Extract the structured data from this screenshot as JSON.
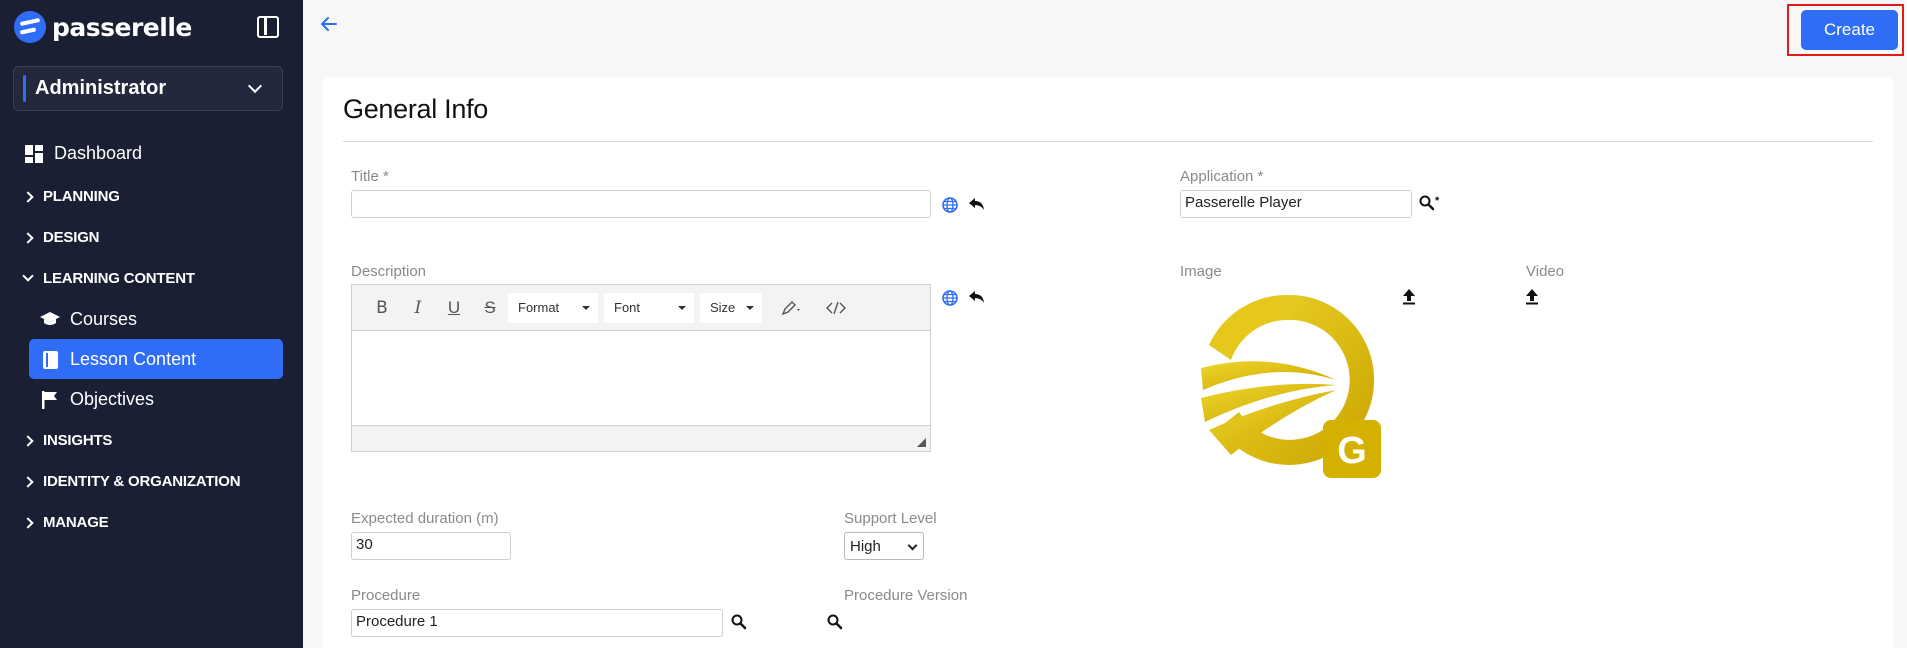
{
  "app": {
    "brand": "passerelle"
  },
  "sidebar": {
    "role": "Administrator",
    "top_item": "Dashboard",
    "sections": [
      {
        "label": "PLANNING"
      },
      {
        "label": "DESIGN"
      },
      {
        "label": "LEARNING CONTENT"
      },
      {
        "label": "INSIGHTS"
      },
      {
        "label": "IDENTITY & ORGANIZATION"
      },
      {
        "label": "MANAGE"
      }
    ],
    "learning_items": [
      {
        "label": "Courses",
        "icon": "graduation-cap-icon"
      },
      {
        "label": "Lesson Content",
        "icon": "book-icon",
        "active": true
      },
      {
        "label": "Objectives",
        "icon": "flag-icon"
      }
    ]
  },
  "header": {
    "create_label": "Create"
  },
  "form": {
    "title": "General Info",
    "title_field": {
      "label": "Title *",
      "value": ""
    },
    "application": {
      "label": "Application *",
      "value": "Passerelle Player"
    },
    "description": {
      "label": "Description",
      "toolbar": {
        "format": "Format",
        "font": "Font",
        "size": "Size"
      }
    },
    "image": {
      "label": "Image",
      "badge_letter": "G"
    },
    "video": {
      "label": "Video"
    },
    "expected_duration": {
      "label": "Expected duration (m)",
      "value": "30"
    },
    "support_level": {
      "label": "Support Level",
      "value": "High"
    },
    "procedure": {
      "label": "Procedure",
      "value": "Procedure 1"
    },
    "procedure_version": {
      "label": "Procedure Version"
    }
  },
  "colors": {
    "sidebar_bg": "#1b1f33",
    "accent": "#2f6df6",
    "highlight": "#e01b1b",
    "logo_gold": "#d4b000"
  }
}
